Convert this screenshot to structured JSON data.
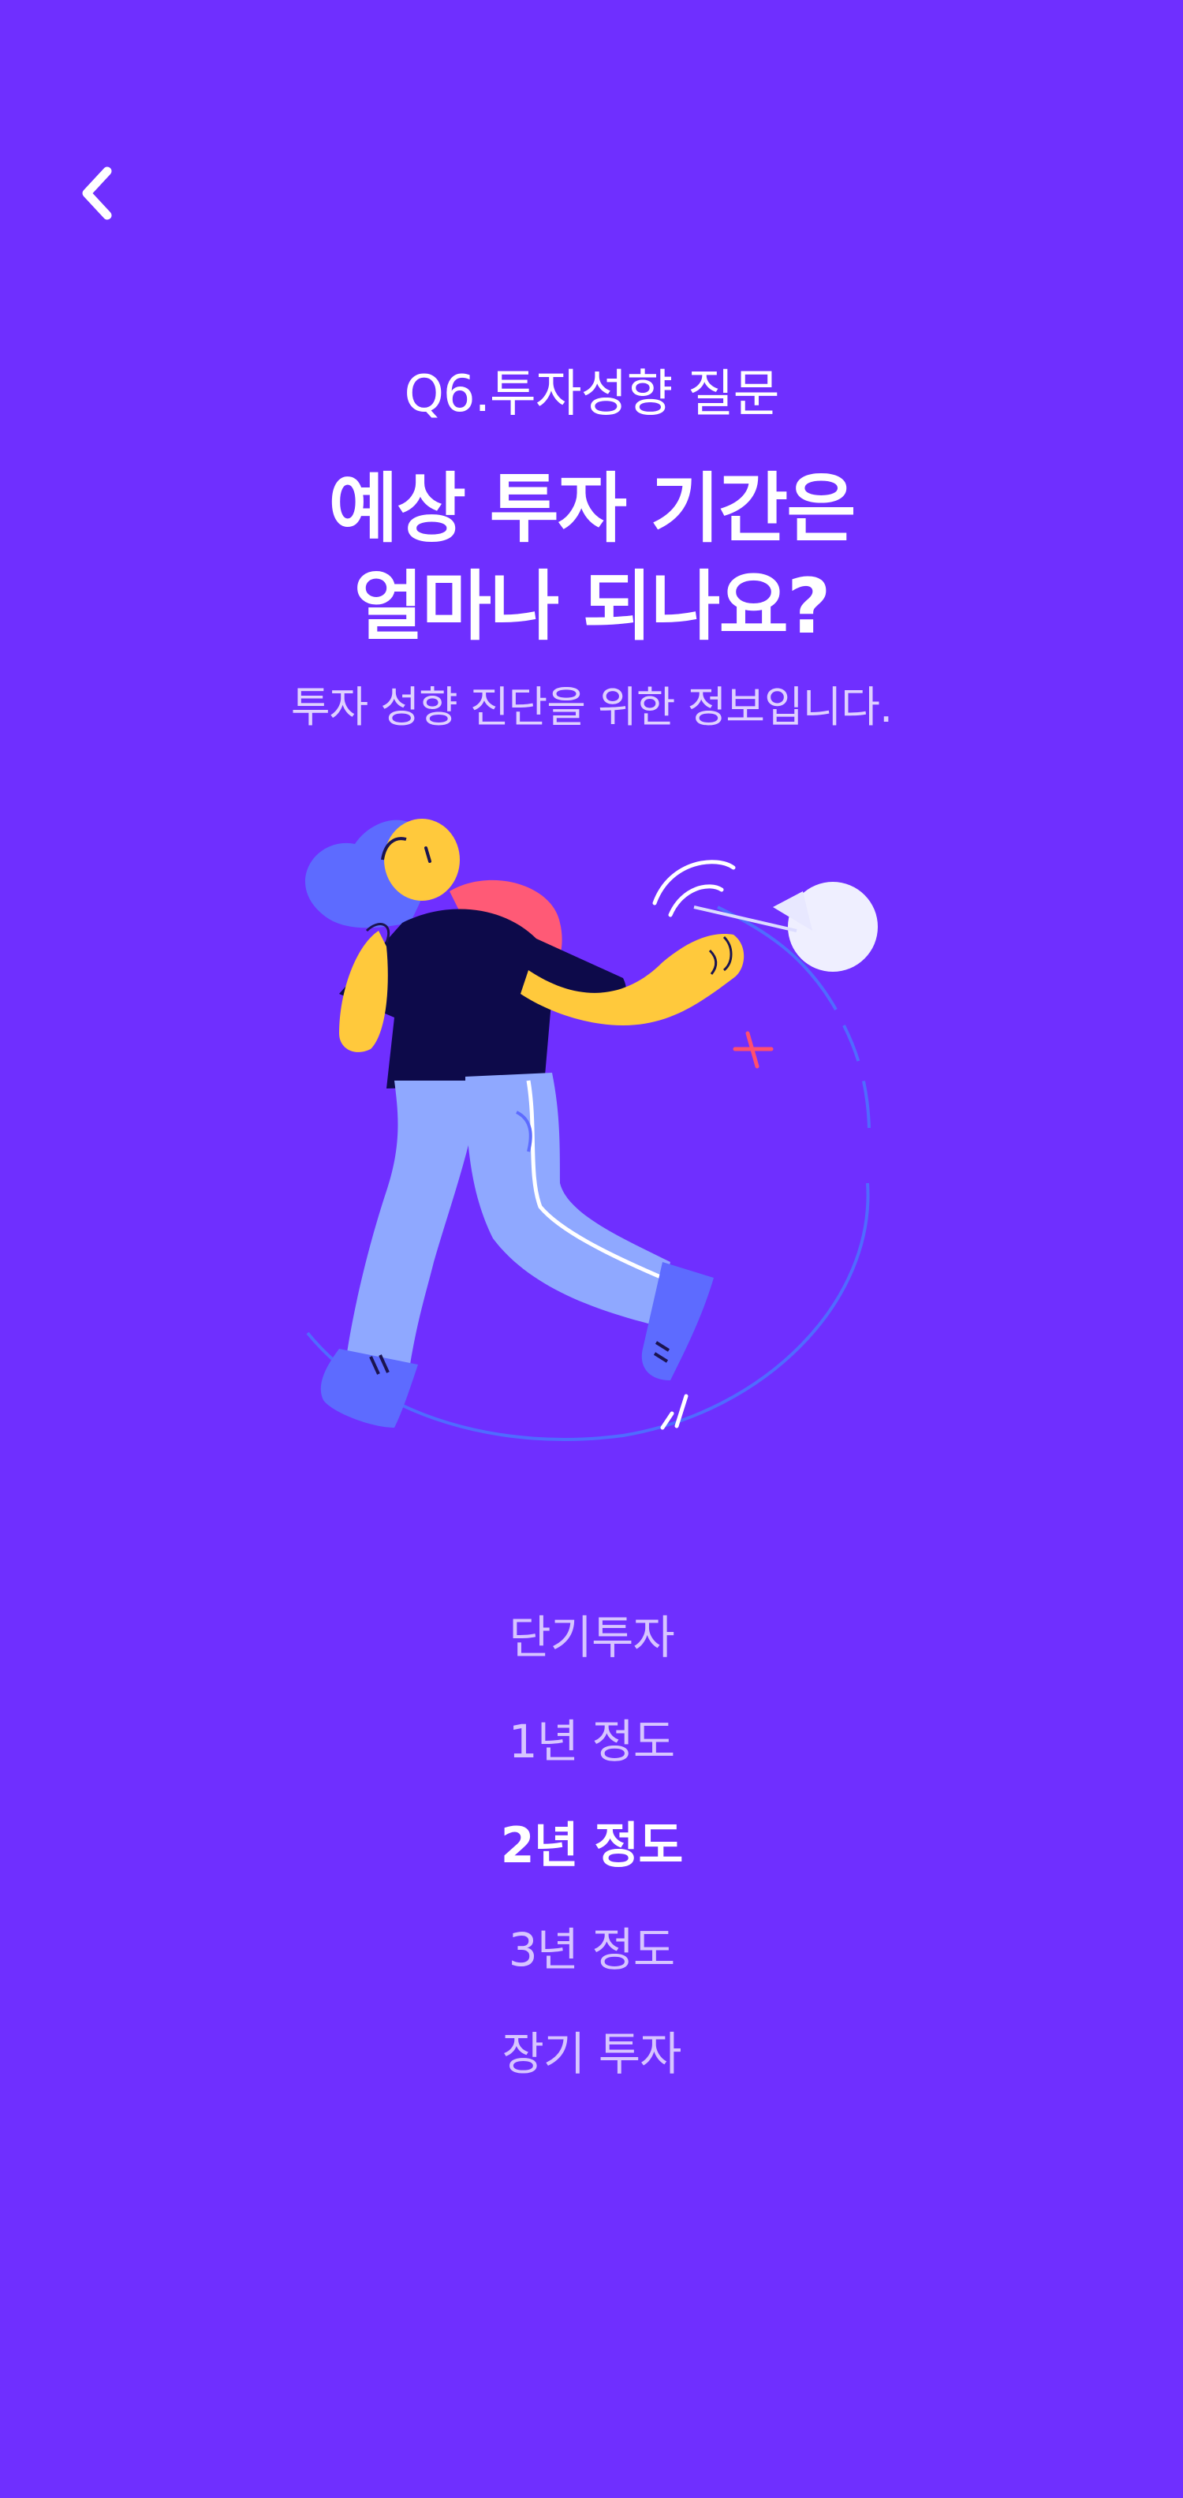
{
  "nav": {
    "back_icon": "chevron-left-icon"
  },
  "header": {
    "question_label": "Q6.투자성향 질문",
    "title_line1": "예상 투자 기간은",
    "title_line2": "얼마나 되나요?",
    "subtitle": "투자 성향 진단을 위한 정보입니다."
  },
  "options": [
    {
      "label": "단기투자",
      "selected": false
    },
    {
      "label": "1년 정도",
      "selected": false
    },
    {
      "label": "2년 정도",
      "selected": true
    },
    {
      "label": "3년 정도",
      "selected": false
    },
    {
      "label": "장기 투자",
      "selected": false
    }
  ],
  "colors": {
    "background": "#6f2fff",
    "text": "#ffffff",
    "illustration_skin": "#ffc93c",
    "illustration_pants": "#8fa8ff",
    "illustration_shirt": "#0d0a4a",
    "illustration_bag": "#ff5a76"
  }
}
